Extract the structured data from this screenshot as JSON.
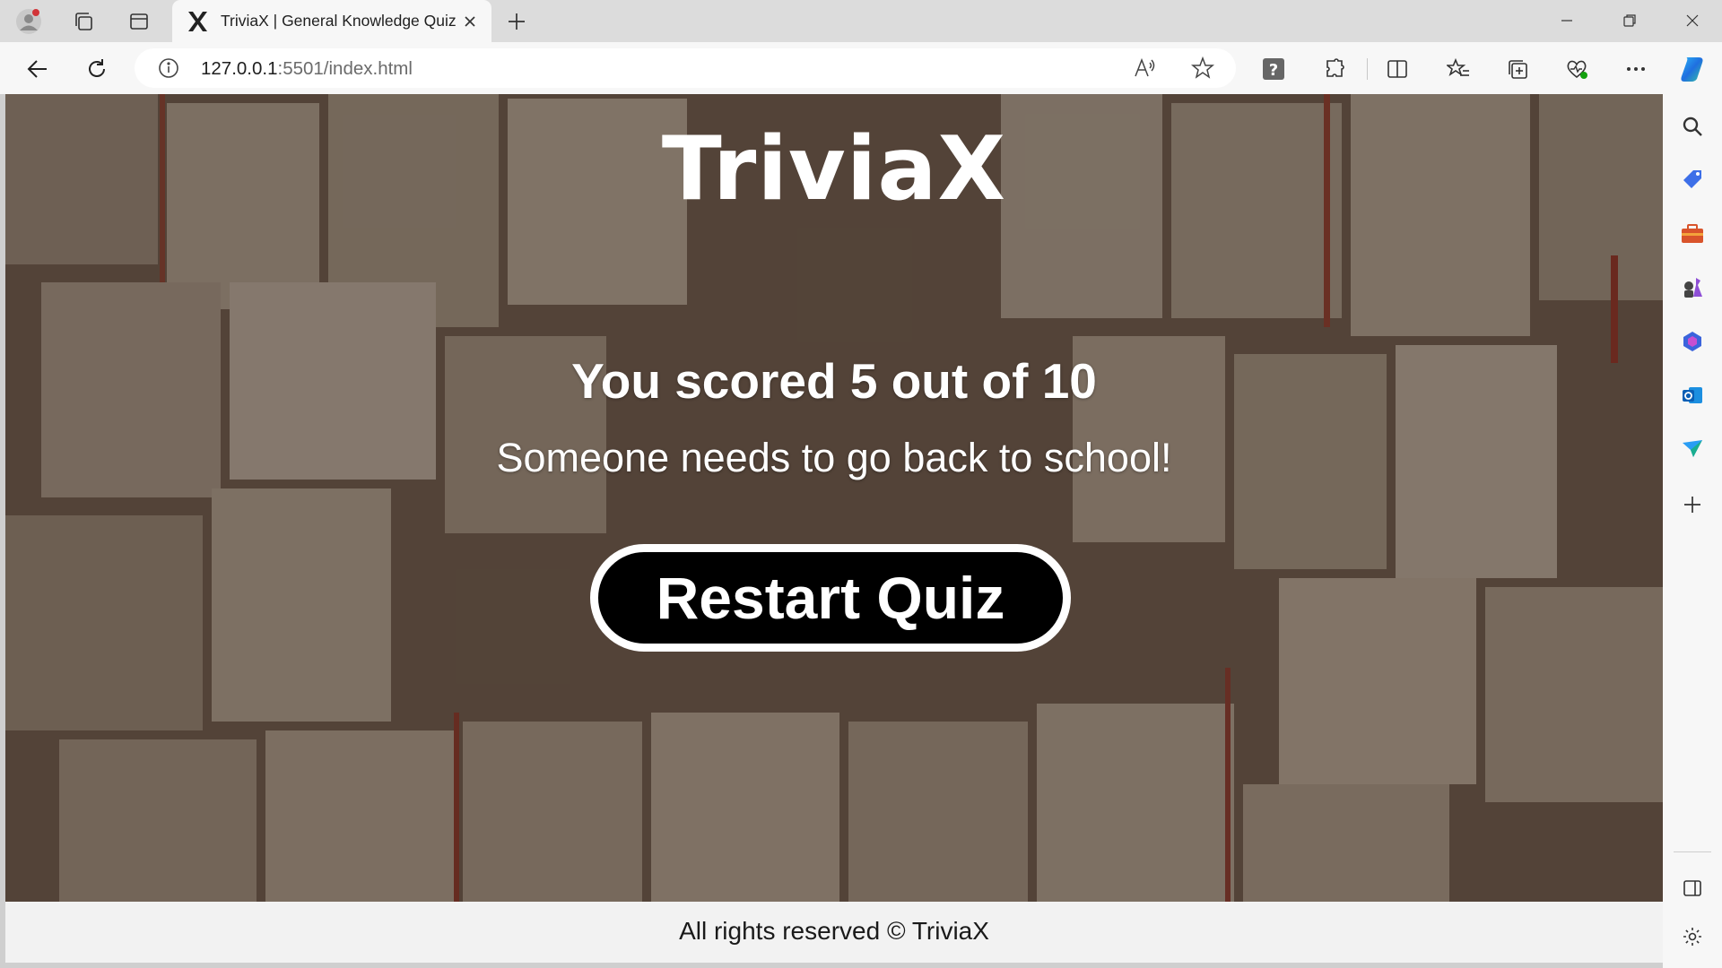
{
  "browser": {
    "tab_title": "TriviaX | General Knowledge Quiz",
    "url_host": "127.0.0.1",
    "url_rest": ":5501/index.html"
  },
  "page": {
    "logo": "TriviaX",
    "score_text": "You scored 5 out of 10",
    "feedback_text": "Someone needs to go back to school!",
    "restart_label": "Restart Quiz",
    "footer_text": "All rights reserved © TriviaX"
  },
  "colors": {
    "accent": "#0078d4",
    "button_bg": "#000000",
    "button_border": "#ffffff",
    "footer_bg": "#f2f2f2"
  }
}
